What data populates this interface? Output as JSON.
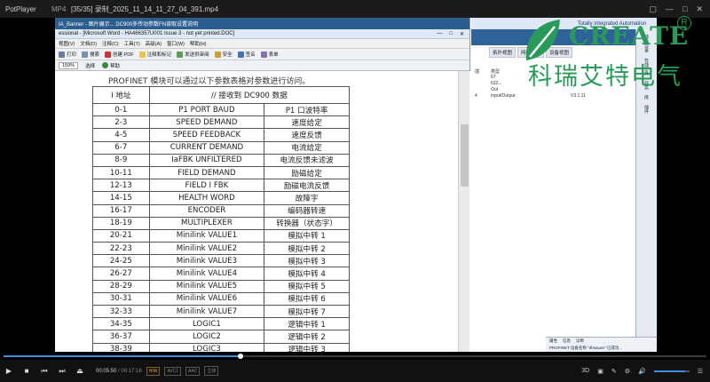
{
  "player": {
    "app_name": "PotPlayer",
    "format": "MP4",
    "file_title": "[35/35] 录制_2025_11_14_11_27_04_391.mp4",
    "window_controls": [
      "▢",
      "—",
      "□",
      "✕"
    ],
    "current_time": "00:05:50",
    "separator": "/",
    "duration": "00:17:16",
    "codec_tags": [
      "H/W",
      "AVC1",
      "AAC",
      "立体"
    ],
    "progress_fraction": 0.337,
    "volume_fraction": 0.88,
    "accent_color": "#3b8ee0",
    "right_controls": [
      "3D",
      "▣",
      "✎",
      "⚙",
      "☰"
    ]
  },
  "word": {
    "outer_title": "IA_Banner - 图片展示... DC900多传动参数FN读取设置说明",
    "title": "essional - [Microsoft Word - HA466357U001 Issue 3 - not yet printed.DOC]",
    "window_controls": [
      "—",
      "□",
      "✕"
    ],
    "menu": [
      "视图(V)",
      "文档(D)",
      "注释(C)",
      "工具(T)",
      "高级(A)",
      "窗口(W)",
      "帮助(H)"
    ],
    "toolbar": [
      "打印",
      "搜索",
      "创建 PDF",
      "注释和标记",
      "发送供审阅",
      "安全",
      "签名",
      "表单"
    ],
    "zoom": "159%",
    "toolbar2": [
      "选择",
      "帮助"
    ],
    "doc_caption": "PROFINET 模块可以通过以下参数表格对参数进行访问。",
    "table": {
      "col1_header": "I 地址",
      "col23_header": "// 接收到 DC900 数据",
      "rows": [
        [
          "0-1",
          "P1 PORT BAUD",
          "P1 口波特率"
        ],
        [
          "2-3",
          "SPEED DEMAND",
          "速度给定"
        ],
        [
          "4-5",
          "SPEED FEEDBACK",
          "速度反馈"
        ],
        [
          "6-7",
          "CURRENT DEMAND",
          "电流给定"
        ],
        [
          "8-9",
          "IaFBK UNFILTERED",
          "电流反馈未滤波"
        ],
        [
          "10-11",
          "FIELD DEMAND",
          "励磁给定"
        ],
        [
          "12-13",
          "FIELD I FBK",
          "励磁电流反馈"
        ],
        [
          "14-15",
          "HEALTH WORD",
          "故障字"
        ],
        [
          "16-17",
          "ENCODER",
          "编码器转速"
        ],
        [
          "18-19",
          "MULTIPLEXER",
          "转换器（状态字）"
        ],
        [
          "20-21",
          "Minilink VALUE1",
          "模拟中转 1"
        ],
        [
          "22-23",
          "Minilink VALUE2",
          "模拟中转 2"
        ],
        [
          "24-25",
          "Minilink VALUE3",
          "模拟中转 3"
        ],
        [
          "26-27",
          "Minilink VALUE4",
          "模拟中转 4"
        ],
        [
          "28-29",
          "Minilink VALUE5",
          "模拟中转 5"
        ],
        [
          "30-31",
          "Minilink VALUE6",
          "模拟中转 6"
        ],
        [
          "32-33",
          "Minilink VALUE7",
          "模拟中转 7"
        ],
        [
          "34-35",
          "LOGIC1",
          "逻辑中转 1"
        ],
        [
          "36-37",
          "LOGIC2",
          "逻辑中转 2"
        ],
        [
          "38-39",
          "LOGIC3",
          "逻辑中转 3"
        ]
      ]
    }
  },
  "tia": {
    "title": "Totally Integrated Automation",
    "tabs": [
      "拓扑视图",
      "网络视图",
      "设备视图"
    ],
    "table_header": [
      "插",
      "类型"
    ],
    "table_rows": [
      [
        "",
        "67",
        ""
      ],
      [
        "",
        "632...",
        ""
      ],
      [
        "",
        "Out",
        ""
      ],
      [
        "4",
        "Input/Output",
        "V3.1.11"
      ]
    ],
    "side_tabs": [
      "硬件目录",
      "在线工具",
      "任务",
      "库",
      "插件"
    ],
    "bottom_tabs": [
      "属性",
      "信息",
      "诊断"
    ],
    "status": "PROFINET 设备名称 \"dhsauan\" 已成功..."
  },
  "watermark": {
    "brand_en": "CREATE",
    "brand_cn": "科瑞艾特电气",
    "reg_mark": "R",
    "color": "#2a9a5a"
  }
}
